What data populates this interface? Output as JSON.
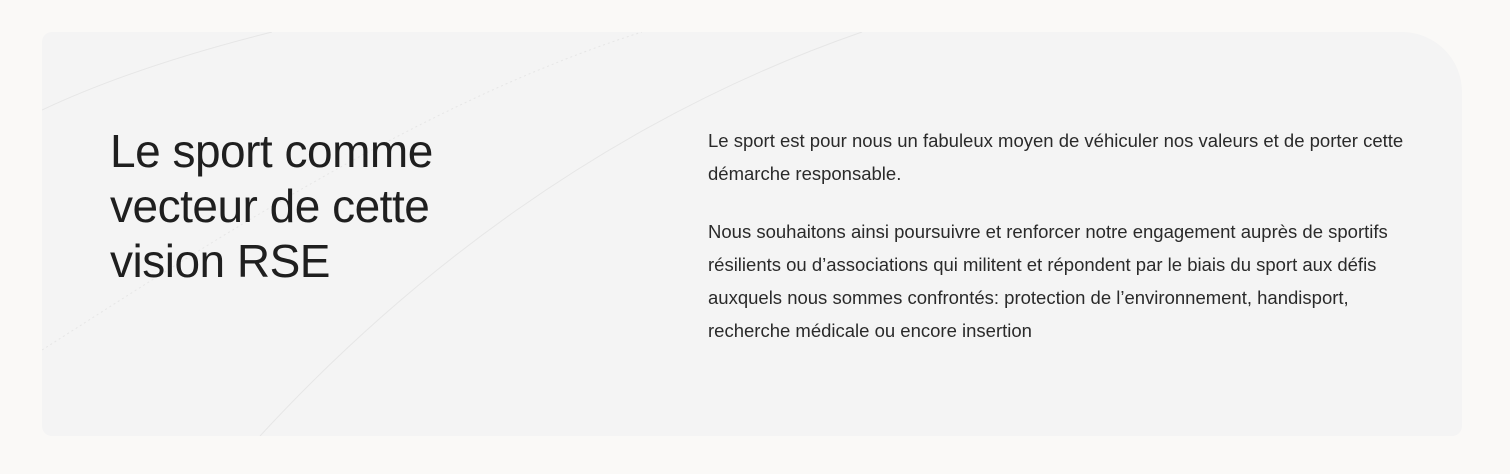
{
  "section": {
    "heading": "Le sport comme vecteur de cette vision RSE",
    "paragraphs": [
      "Le sport est pour nous un fabuleux moyen de véhiculer nos valeurs et de porter cette démarche responsable.",
      "Nous souhaitons ainsi poursuivre et renforcer notre engagement auprès de sportifs résilients ou d’associations qui militent et répondent par le biais du sport aux défis auxquels nous sommes confrontés: protection de l’environnement, handisport, recherche médicale ou encore insertion"
    ]
  },
  "colors": {
    "page_background": "#faf9f7",
    "card_background": "#f4f4f4",
    "text": "#1f1f1f"
  }
}
